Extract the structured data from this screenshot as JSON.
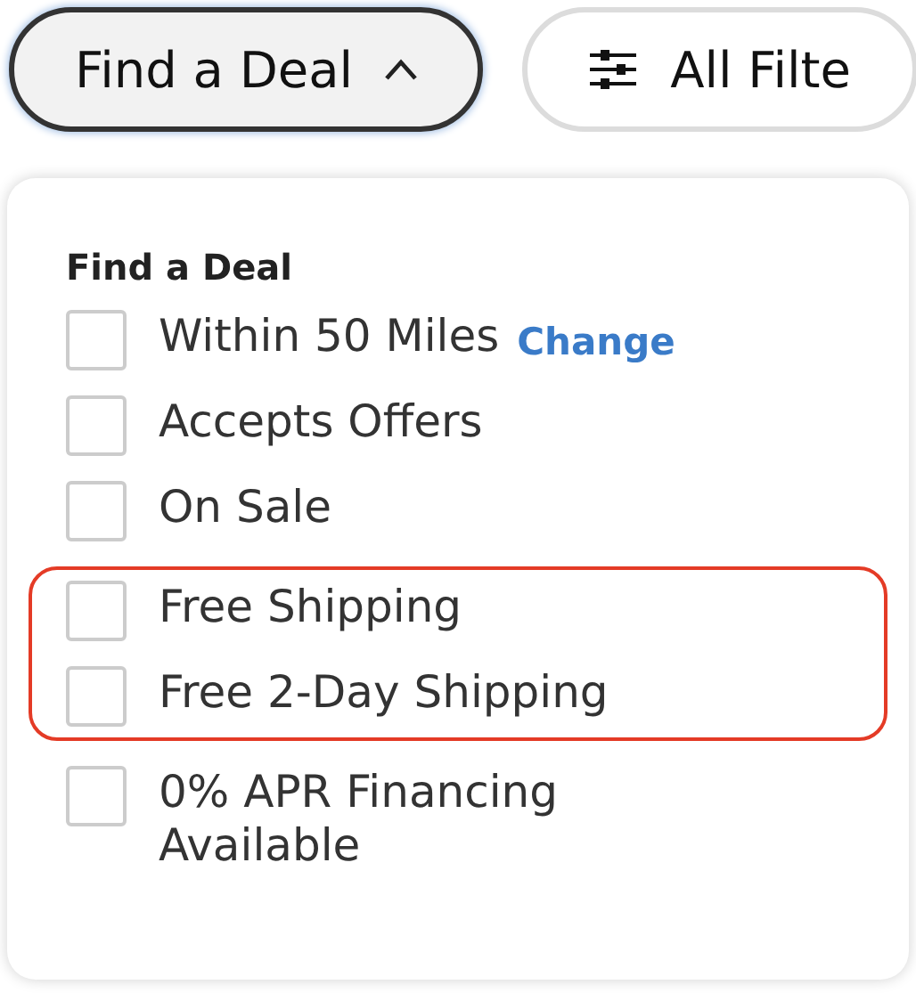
{
  "filter_buttons": [
    {
      "label": "Find a Deal",
      "kind": "dropdown",
      "expanded": true
    },
    {
      "label": "All Filte",
      "kind": "filters",
      "expanded": false
    }
  ],
  "dropdown": {
    "title": "Find a Deal",
    "options": [
      {
        "label": "Within 50 Miles",
        "link": "Change",
        "checked": false,
        "highlighted": false
      },
      {
        "label": "Accepts Offers",
        "checked": false,
        "highlighted": false
      },
      {
        "label": "On Sale",
        "checked": false,
        "highlighted": false
      },
      {
        "label": "Free Shipping",
        "checked": false,
        "highlighted": true
      },
      {
        "label": "Free 2-Day Shipping",
        "checked": false,
        "highlighted": true
      },
      {
        "label": "0% APR Financing Available",
        "checked": false,
        "highlighted": false
      }
    ]
  }
}
